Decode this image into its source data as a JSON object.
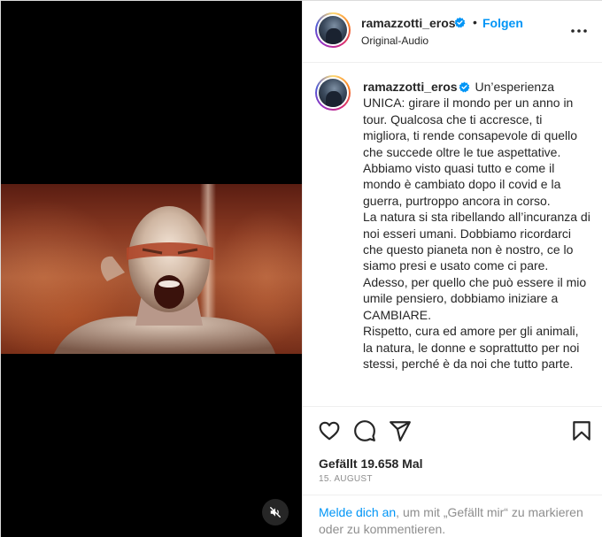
{
  "post": {
    "username": "ramazzotti_eros",
    "follow_label": "Folgen",
    "separator": "•",
    "audio_label": "Original-Audio",
    "caption": "Un’esperienza UNICA: girare il mondo per un anno in tour. Qualcosa che ti accresce, ti migliora, ti rende consapevole di quello che succede oltre le tue aspettative. Abbiamo visto quasi tutto e come il mondo è cambiato dopo il covid e la guerra, purtroppo ancora in corso.\nLa natura si sta ribellando all’incuranza di noi esseri umani. Dobbiamo ricordarci che questo pianeta non è nostro, ce lo siamo presi e usato come ci pare. Adesso, per quello che può essere il mio umile pensiero, dobbiamo iniziare a CAMBIARE.\nRispetto, cura ed amore per gli animali, la natura, le donne e soprattutto per noi stessi, perché è da noi che tutto parte.",
    "likes_text": "Gefällt 19.658 Mal",
    "date_text": "15. AUGUST"
  },
  "login_prompt": {
    "link_text": "Melde dich an",
    "rest_text": ", um mit „Gefällt mir“ zu markieren oder zu kommentieren."
  },
  "icons": {
    "verified": "verified-badge-icon",
    "more": "more-options-icon",
    "like": "heart-icon",
    "comment": "comment-icon",
    "share": "share-icon",
    "save": "bookmark-icon",
    "mute": "muted-speaker-icon"
  },
  "colors": {
    "accent": "#0095f6",
    "text": "#262626",
    "muted": "#8e8e8e",
    "media_bg": "#000000"
  }
}
